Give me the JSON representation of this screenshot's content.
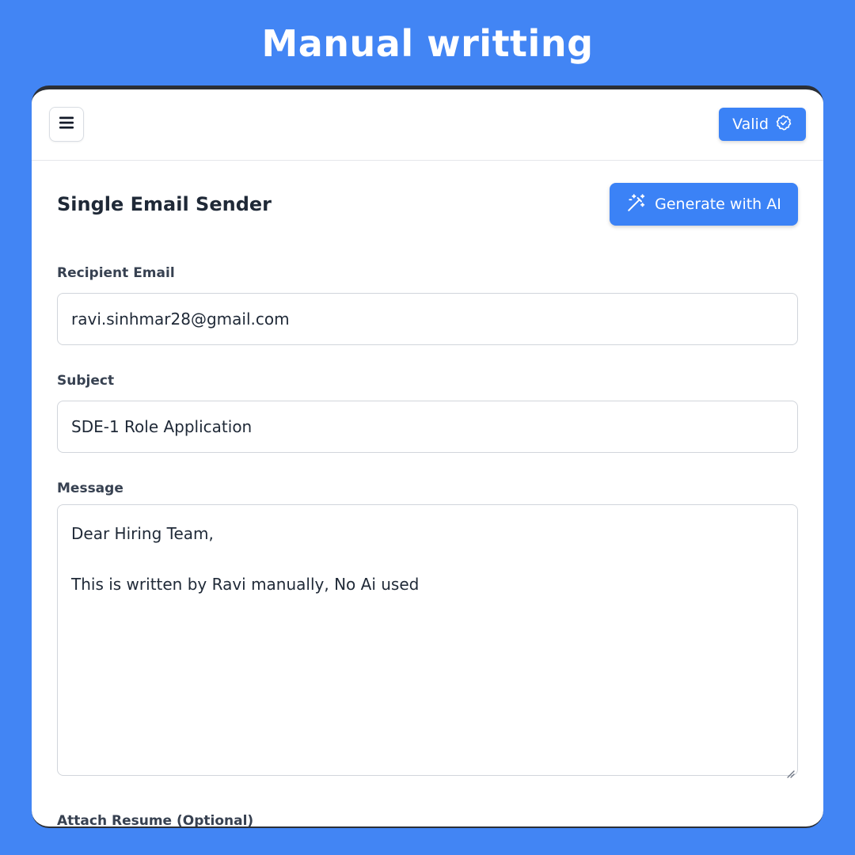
{
  "banner": {
    "title": "Manual writting"
  },
  "header": {
    "menu_icon": "hamburger-menu-icon",
    "valid_label": "Valid",
    "valid_icon": "badge-check-icon"
  },
  "main": {
    "title": "Single Email Sender",
    "generate_label": "Generate with AI",
    "generate_icon": "magic-wand-icon"
  },
  "form": {
    "recipient": {
      "label": "Recipient Email",
      "value": "ravi.sinhmar28@gmail.com"
    },
    "subject": {
      "label": "Subject",
      "value": "SDE-1 Role Application"
    },
    "message": {
      "label": "Message",
      "lines": [
        "Dear Hiring Team,",
        "",
        "This is written by Ravi manually, No Ai used"
      ]
    },
    "attachment": {
      "label": "Attach Resume (Optional)"
    }
  },
  "colors": {
    "background": "#4285f4",
    "accent": "#3b82f6",
    "text": "#1f2937"
  }
}
